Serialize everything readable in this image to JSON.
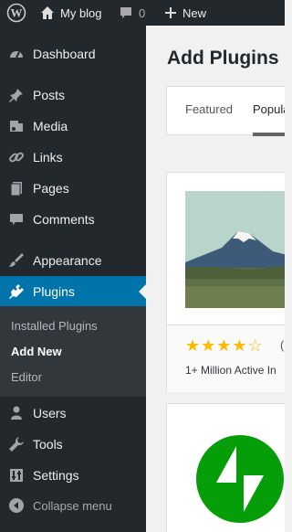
{
  "adminbar": {
    "site_name": "My blog",
    "comments_count": "0",
    "new_label": "New"
  },
  "sidebar": {
    "items": [
      {
        "label": "Dashboard",
        "icon": "dashboard-icon"
      },
      {
        "label": "Posts",
        "icon": "pin-icon"
      },
      {
        "label": "Media",
        "icon": "media-icon"
      },
      {
        "label": "Links",
        "icon": "link-icon"
      },
      {
        "label": "Pages",
        "icon": "pages-icon"
      },
      {
        "label": "Comments",
        "icon": "comment-icon"
      },
      {
        "label": "Appearance",
        "icon": "brush-icon"
      },
      {
        "label": "Plugins",
        "icon": "plugin-icon"
      },
      {
        "label": "Users",
        "icon": "user-icon"
      },
      {
        "label": "Tools",
        "icon": "wrench-icon"
      },
      {
        "label": "Settings",
        "icon": "settings-icon"
      }
    ],
    "submenu": [
      "Installed Plugins",
      "Add New",
      "Editor"
    ],
    "collapse_label": "Collapse menu"
  },
  "main": {
    "title": "Add Plugins",
    "tabs": [
      "Featured",
      "Popular"
    ],
    "cards": [
      {
        "rating_count": "(",
        "installs": "1+ Million Active In",
        "rating": 4.5
      }
    ]
  },
  "colors": {
    "sidebar": "#23282d",
    "active": "#0073aa",
    "star": "#ffb900",
    "jetpack": "#069e08"
  }
}
